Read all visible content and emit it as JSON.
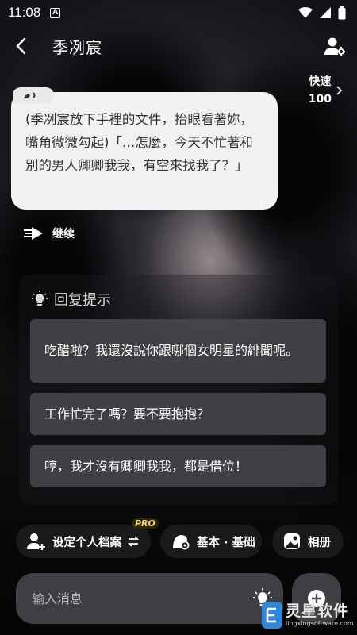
{
  "status_bar": {
    "time": "11:08",
    "notification_badge": "A"
  },
  "header": {
    "title": "季冽宸"
  },
  "speed": {
    "label": "快速",
    "value": "100"
  },
  "message": {
    "text": "(季冽宸放下手裡的文件，抬眼看著妳，嘴角微微勾起)「…怎麼，今天不忙著和別的男人卿卿我我，有空來找我了？」"
  },
  "continue_label": "继续",
  "reply_hints": {
    "title": "回复提示",
    "suggestions": [
      "吃醋啦？我還沒說你跟哪個女明星的緋聞呢。",
      "工作忙完了嗎？要不要抱抱？",
      "哼，我才沒有卿卿我我，都是借位！"
    ]
  },
  "chips": {
    "profile": "设定个人档案",
    "pro_badge": "PRO",
    "basic": "基本 · 基础",
    "album": "相册"
  },
  "input": {
    "placeholder": "输入消息"
  },
  "watermark": {
    "name": "灵星软件",
    "url": "lingxingsoftware.com"
  },
  "colors": {
    "bubble_bg": "#f2f2f2",
    "bubble_text": "#333333",
    "suggestion_bg": "#48484c",
    "pro_badge": "#ffd86b",
    "watermark_logo": "#2f88d9"
  }
}
